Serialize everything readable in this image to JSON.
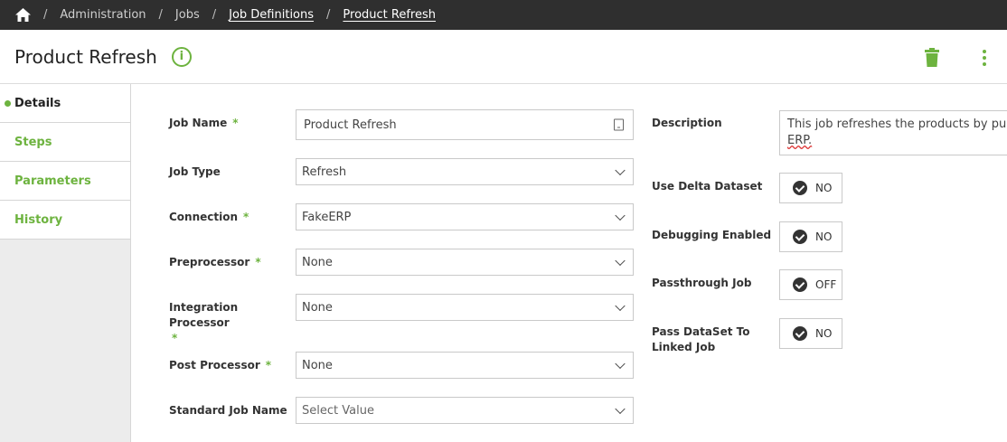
{
  "breadcrumb": {
    "items": [
      {
        "label": "Administration",
        "link": false
      },
      {
        "label": "Jobs",
        "link": false
      },
      {
        "label": "Job Definitions",
        "link": true
      },
      {
        "label": "Product Refresh",
        "link": true
      }
    ],
    "separator": "/"
  },
  "header": {
    "title": "Product Refresh",
    "info_glyph": "i"
  },
  "sidebar": {
    "items": [
      {
        "label": "Details",
        "active": true
      },
      {
        "label": "Steps",
        "active": false
      },
      {
        "label": "Parameters",
        "active": false
      },
      {
        "label": "History",
        "active": false
      }
    ]
  },
  "form": {
    "required_mark": "*",
    "job_name": {
      "label": "Job Name",
      "value": "Product Refresh"
    },
    "job_type": {
      "label": "Job Type",
      "value": "Refresh"
    },
    "connection": {
      "label": "Connection",
      "value": "FakeERP"
    },
    "preprocessor": {
      "label": "Preprocessor",
      "value": "None"
    },
    "integration_processor": {
      "label": "Integration Processor",
      "value": "None"
    },
    "post_processor": {
      "label": "Post Processor",
      "value": "None"
    },
    "standard_job_name": {
      "label": "Standard Job Name",
      "placeholder": "Select Value"
    },
    "description": {
      "label": "Description",
      "line1": "This job refreshes the products by pullin",
      "line2": "ERP."
    },
    "use_delta_dataset": {
      "label": "Use Delta Dataset",
      "value": "NO"
    },
    "debugging_enabled": {
      "label": "Debugging Enabled",
      "value": "NO"
    },
    "passthrough_job": {
      "label": "Passthrough Job",
      "value": "OFF"
    },
    "pass_dataset": {
      "label_line1": "Pass DataSet To",
      "label_line2": "Linked Job",
      "value": "NO"
    }
  },
  "colors": {
    "accent": "#6db33f",
    "topbar": "#2f2f2f"
  },
  "icons": [
    "home-icon",
    "info-icon",
    "trash-icon",
    "more-vertical-icon",
    "contact-card-icon",
    "chevron-down-icon",
    "check-circle-icon"
  ]
}
